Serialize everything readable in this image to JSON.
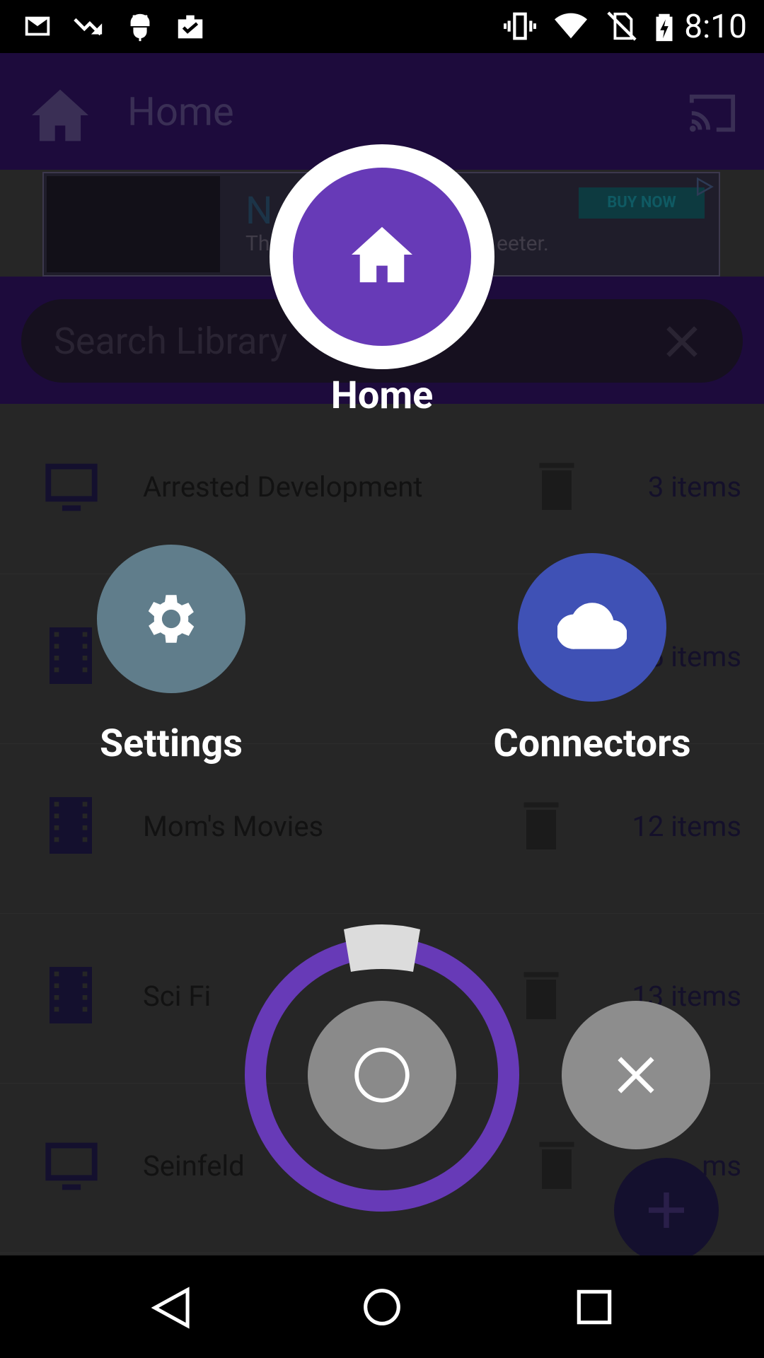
{
  "status_bar": {
    "time": "8:10",
    "left_icons": [
      "gmail-icon",
      "trending-down-icon",
      "android-icon",
      "clipboard-check-icon"
    ],
    "right_icons": [
      "vibrate-icon",
      "wifi-icon",
      "no-sim-icon",
      "battery-charging-icon"
    ]
  },
  "app": {
    "toolbar": {
      "title": "Home"
    },
    "ad": {
      "headline": "N",
      "sub_text": "Th",
      "sub_text_end": "eeter.",
      "cta": "BUY NOW"
    },
    "search": {
      "placeholder": "Search Library"
    },
    "library": [
      {
        "title": "Arrested Development",
        "count": "3 items",
        "icon": "tv-icon"
      },
      {
        "title": "",
        "count": "5 items",
        "icon": "film-icon"
      },
      {
        "title": "Mom's Movies",
        "count": "12 items",
        "icon": "film-icon"
      },
      {
        "title": "Sci Fi",
        "count": "13 items",
        "icon": "film-icon"
      },
      {
        "title": "Seinfeld",
        "count": "ms",
        "icon": "tv-icon"
      }
    ]
  },
  "radial_menu": {
    "home_label": "Home",
    "settings_label": "Settings",
    "connectors_label": "Connectors"
  },
  "colors": {
    "accent": "#673ab7",
    "settings": "#607d8b",
    "connectors": "#3f51b5",
    "dial_button": "#8a8a8a"
  }
}
